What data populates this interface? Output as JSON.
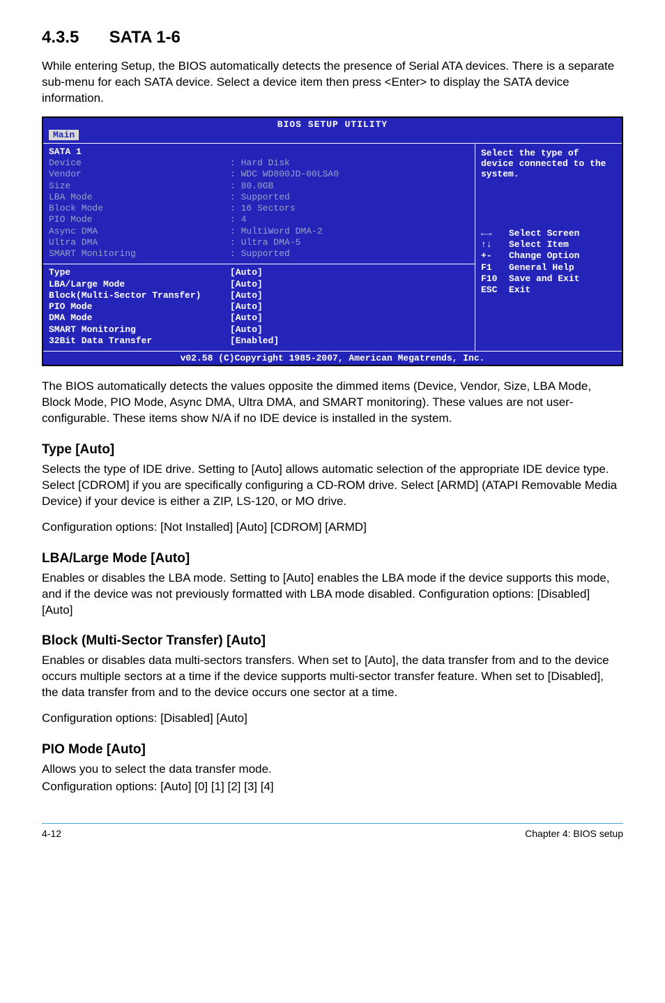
{
  "section": {
    "number": "4.3.5",
    "title": "SATA 1-6"
  },
  "intro": "While entering Setup, the BIOS automatically detects the presence of Serial ATA devices. There is a separate sub-menu for each SATA device. Select a device item then press <Enter> to display the SATA device information.",
  "bios": {
    "title": "BIOS SETUP UTILITY",
    "tab": "Main",
    "panel_title": "SATA 1",
    "info": [
      {
        "label": "Device",
        "value": ": Hard Disk"
      },
      {
        "label": "Vendor",
        "value": ": WDC WD800JD-00LSA0"
      },
      {
        "label": "Size",
        "value": ": 80.0GB"
      },
      {
        "label": "LBA Mode",
        "value": ": Supported"
      },
      {
        "label": "Block Mode",
        "value": ": 16 Sectors"
      },
      {
        "label": "PIO Mode",
        "value": ": 4"
      },
      {
        "label": "Async DMA",
        "value": ": MultiWord DMA-2"
      },
      {
        "label": "Ultra DMA",
        "value": ": Ultra DMA-5"
      },
      {
        "label": "SMART Monitoring",
        "value": ": Supported"
      }
    ],
    "options": [
      {
        "label": "Type",
        "value": "[Auto]"
      },
      {
        "label": "LBA/Large Mode",
        "value": "[Auto]"
      },
      {
        "label": "Block(Multi-Sector Transfer)",
        "value": "[Auto]"
      },
      {
        "label": "PIO Mode",
        "value": "[Auto]"
      },
      {
        "label": "DMA Mode",
        "value": "[Auto]"
      },
      {
        "label": "SMART Monitoring",
        "value": "[Auto]"
      },
      {
        "label": "32Bit Data Transfer",
        "value": "[Enabled]"
      }
    ],
    "help_top": "Select the type of device connected to the system.",
    "legend": [
      {
        "key": "←→",
        "desc": "Select Screen"
      },
      {
        "key": "↑↓",
        "desc": "Select Item"
      },
      {
        "key": "+-",
        "desc": "Change Option"
      },
      {
        "key": "F1",
        "desc": "General Help"
      },
      {
        "key": "F10",
        "desc": "Save and Exit"
      },
      {
        "key": "ESC",
        "desc": "Exit"
      }
    ],
    "footer": "v02.58 (C)Copyright 1985-2007, American Megatrends, Inc."
  },
  "after_bios": "The BIOS automatically detects the values opposite the dimmed items (Device, Vendor, Size, LBA Mode, Block Mode, PIO Mode, Async DMA, Ultra DMA, and SMART monitoring). These values are not user-configurable. These items show N/A if no IDE device is installed in the system.",
  "subs": {
    "type": {
      "heading": "Type [Auto]",
      "p1": "Selects the type of IDE drive. Setting to [Auto] allows automatic selection of the appropriate IDE device type. Select [CDROM] if you are specifically configuring a CD-ROM drive. Select [ARMD] (ATAPI Removable Media Device) if your device is either a ZIP, LS-120, or MO drive.",
      "p2": "Configuration options: [Not Installed] [Auto] [CDROM] [ARMD]"
    },
    "lba": {
      "heading": "LBA/Large Mode [Auto]",
      "p1": "Enables or disables the LBA mode. Setting to [Auto] enables the LBA mode if the device supports this mode, and if the device was not previously formatted with LBA mode disabled. Configuration options: [Disabled] [Auto]"
    },
    "block": {
      "heading": "Block (Multi-Sector Transfer) [Auto]",
      "p1": "Enables or disables data multi-sectors transfers. When set to [Auto], the data transfer from and to the device occurs multiple sectors at a time if the device supports multi-sector transfer feature. When set to [Disabled], the data transfer from and to the device occurs one sector at a time.",
      "p2": "Configuration options: [Disabled] [Auto]"
    },
    "pio": {
      "heading": "PIO Mode [Auto]",
      "p1": "Allows you to select the data transfer mode.",
      "p2": "Configuration options: [Auto] [0] [1] [2] [3] [4]"
    }
  },
  "footer": {
    "left": "4-12",
    "right": "Chapter 4: BIOS setup"
  }
}
